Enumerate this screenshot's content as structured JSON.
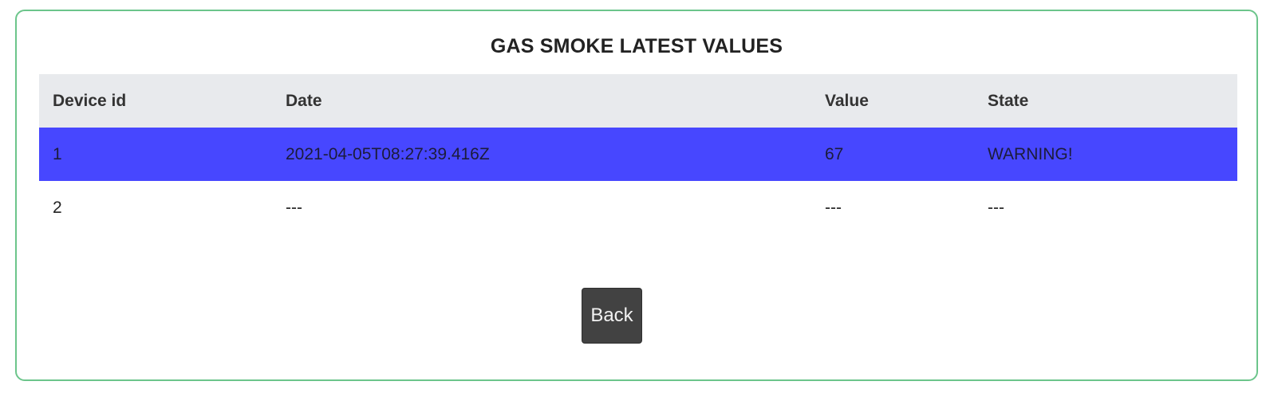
{
  "page": {
    "title": "GAS SMOKE LATEST VALUES"
  },
  "table": {
    "headers": {
      "device_id": "Device id",
      "date": "Date",
      "value": "Value",
      "state": "State"
    },
    "rows": [
      {
        "device_id": "1",
        "date": "2021-04-05T08:27:39.416Z",
        "value": "67",
        "state": "WARNING!",
        "highlight_color": "#4747ff"
      },
      {
        "device_id": "2",
        "date": "---",
        "value": "---",
        "state": "---"
      }
    ]
  },
  "actions": {
    "back_label": "Back"
  },
  "colors": {
    "card_border": "#6cc58b",
    "header_bg": "#e8eaed",
    "button_bg": "#424242"
  }
}
